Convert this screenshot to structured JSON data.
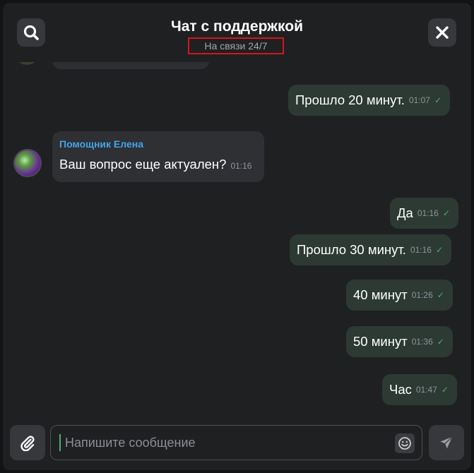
{
  "header": {
    "title": "Чат с поддержкой",
    "subtitle": "На связи 24/7",
    "search_icon": "search-icon",
    "close_icon": "close-icon",
    "highlight_color": "#d3161a"
  },
  "messages": [
    {
      "direction": "out",
      "text": "Прошло 20 минут.",
      "time": "01:07",
      "status": "✓"
    },
    {
      "direction": "in",
      "sender": "Помощник Елена",
      "text": "Ваш вопрос еще актуален?",
      "time": "01:16"
    },
    {
      "direction": "out",
      "text": "Да",
      "time": "01:16",
      "status": "✓"
    },
    {
      "direction": "out",
      "text": "Прошло 30 минут.",
      "time": "01:16",
      "status": "✓"
    },
    {
      "direction": "out",
      "text": "40 минут",
      "time": "01:26",
      "status": "✓"
    },
    {
      "direction": "out",
      "text": "50 минут",
      "time": "01:36",
      "status": "✓"
    },
    {
      "direction": "out",
      "text": "Час",
      "time": "01:47",
      "status": "✓"
    }
  ],
  "composer": {
    "placeholder": "Напишите сообщение",
    "value": "",
    "attach_icon": "paperclip-icon",
    "emoji_icon": "emoji-icon",
    "send_icon": "send-icon"
  },
  "colors": {
    "outgoing_bubble": "#2c3a33",
    "incoming_bubble": "#2e3034",
    "sender_name": "#42a5e8",
    "read_check": "#4fae6f"
  }
}
